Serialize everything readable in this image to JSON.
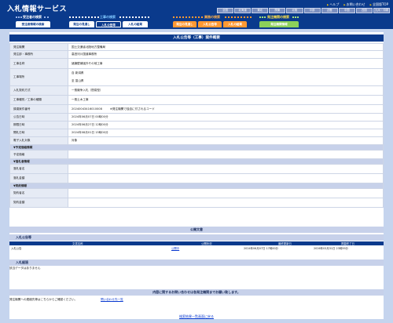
{
  "header": {
    "app_title": "入札情報サービス",
    "top_links": [
      "ヘルプ",
      "お問い合わせ",
      "全国版TOP"
    ],
    "regions": [
      "全国",
      "北海道",
      "東北",
      "関東",
      "北陸",
      "中部",
      "近畿",
      "中国",
      "四国",
      "九州・沖縄"
    ]
  },
  "sections": {
    "juchu": "受注者の検索",
    "koji": "工事の検索",
    "gyomu": "業務の検索",
    "hatchu": "発注機関の検索"
  },
  "tabs": [
    "受注者情報の検索",
    "発注の見通し",
    "入札公告等",
    "入札の結果",
    "発注の見通し",
    "入札公告等",
    "入札の結果",
    "発注機関情報"
  ],
  "page_title": "入札公告等（工事）案件概要",
  "rows": [
    {
      "k": "発注機関",
      "v": "国土交通省北陸地方整備局"
    },
    {
      "k": "発注部・事務所",
      "v": "高田河川国道事務所"
    },
    {
      "k": "工事名称",
      "v": "諸擁壁補強外その他工事"
    },
    {
      "k": "工事場所",
      "v": "自 新潟県",
      "v2": "至 富山県"
    },
    {
      "k": "入札契約方式",
      "v": "一般競争入札（簡易型）"
    },
    {
      "k": "工事種別／工事の種類",
      "v": "一般土木工事"
    },
    {
      "k": "調達案件番号",
      "v": "20240043416010008",
      "v2": "※発注機関で独自に付されるコード"
    },
    {
      "k": "公告日時",
      "v": "2024年06月07日 00時00分"
    },
    {
      "k": "期限日時",
      "v": "2024年06月27日 12時00分"
    },
    {
      "k": "開札日時",
      "v": "2024年08月01日 15時00分"
    },
    {
      "k": "電子入札対象",
      "v": "対象"
    }
  ],
  "sec_yotei": "▼予定価格情報",
  "row_yotei": "予定価格",
  "sec_rakusatsu": "▼落札者情報",
  "rows_rakusatsu": [
    "落札者名",
    "落札金額"
  ],
  "sec_keiyaku": "▼契約情報",
  "rows_keiyaku": [
    "契約者名",
    "契約金額"
  ],
  "public_docs": {
    "header": "公開文書",
    "sub_title": "入札公告等",
    "columns": [
      "文書名称",
      "公開状況",
      "最終更新日",
      "掲載終了日"
    ],
    "row": [
      "入札公告",
      "公開中",
      "2024年06月07日 17時00分",
      "2026年03月31日 23時59分"
    ],
    "sub_title2": "入札経過",
    "empty_note": "該当データはありません"
  },
  "notice": "内容に関するお問い合わせは各発注機関までお願い致します。",
  "contact_text": "発注機関への連絡先等はこちらからご確認ください。",
  "contact_link": "問い合わせ先一覧",
  "back_link": "検索結果一覧画面に戻る"
}
